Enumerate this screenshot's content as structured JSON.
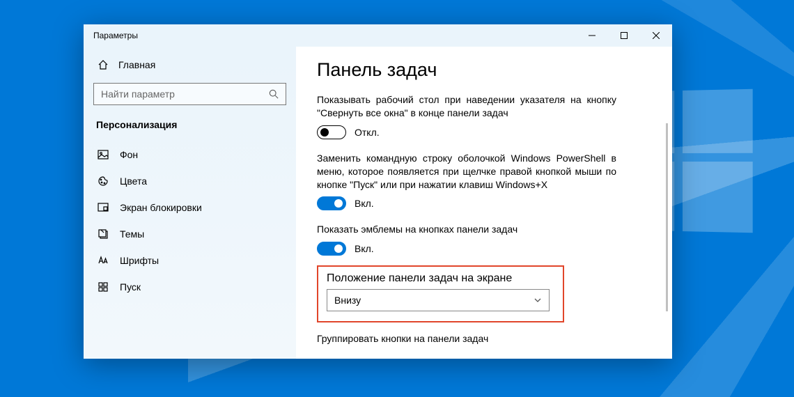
{
  "window": {
    "title": "Параметры"
  },
  "sidebar": {
    "home_label": "Главная",
    "search_placeholder": "Найти параметр",
    "section_title": "Персонализация",
    "items": [
      {
        "label": "Фон"
      },
      {
        "label": "Цвета"
      },
      {
        "label": "Экран блокировки"
      },
      {
        "label": "Темы"
      },
      {
        "label": "Шрифты"
      },
      {
        "label": "Пуск"
      }
    ]
  },
  "content": {
    "heading": "Панель задач",
    "settings": [
      {
        "label": "Показывать рабочий стол при наведении указателя на кнопку \"Свернуть все окна\" в конце панели задач",
        "toggle_on": false,
        "state_text": "Откл."
      },
      {
        "label": "Заменить командную строку оболочкой Windows PowerShell в меню, которое появляется при щелчке правой кнопкой мыши по кнопке \"Пуск\" или при нажатии клавиш Windows+X",
        "toggle_on": true,
        "state_text": "Вкл."
      },
      {
        "label": "Показать эмблемы на кнопках панели задач",
        "toggle_on": true,
        "state_text": "Вкл."
      }
    ],
    "position_section": {
      "label": "Положение панели задач на экране",
      "selected": "Внизу"
    },
    "group_section": {
      "label": "Группировать кнопки на панели задач"
    }
  }
}
